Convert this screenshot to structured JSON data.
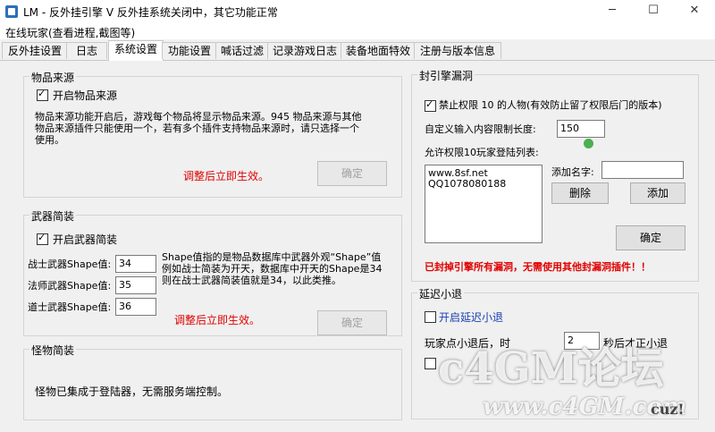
{
  "window": {
    "title": "LM - 反外挂引擎 V 反外挂系统关闭中，其它功能正常",
    "minimize": "─",
    "maximize": "☐",
    "close": "✕"
  },
  "menu": {
    "online_players": "在线玩家(查看进程,截图等)"
  },
  "tabs": [
    "反外挂设置",
    "日志",
    "系统设置",
    "功能设置",
    "喊话过滤",
    "记录游戏日志",
    "装备地面特效",
    "注册与版本信息"
  ],
  "item_source": {
    "group_title": "物品来源",
    "enable_label": "开启物品来源",
    "description": "物品来源功能开启后，游戏每个物品将显示物品来源。945 物品来源与其他物品来源插件只能使用一个，若有多个插件支持物品来源时，请只选择一个使用。",
    "note": "调整后立即生效。",
    "confirm": "确定"
  },
  "weapon_simple": {
    "group_title": "武器简装",
    "enable_label": "开启武器简装",
    "warrior_label": "战士武器Shape值:",
    "warrior_value": "34",
    "mage_label": "法师武器Shape值:",
    "mage_value": "35",
    "taoist_label": "道士武器Shape值:",
    "taoist_value": "36",
    "description": "Shape值指的是物品数据库中武器外观“Shape”值例如战士简装为开天，数据库中开天的Shape是34则在战士武器简装值就是34，以此类推。",
    "note": "调整后立即生效。",
    "confirm": "确定"
  },
  "monster_simple": {
    "group_title": "怪物简装",
    "description": "怪物已集成于登陆器，无需服务端控制。"
  },
  "engine_block": {
    "group_title": "封引擎漏洞",
    "ban_label": "禁止权限 10 的人物(有效防止留了权限后门的版本)",
    "custom_len_label": "自定义输入内容限制长度:",
    "custom_len_value": "150",
    "allow_list_label": "允许权限10玩家登陆列表:",
    "allow_list": [
      "www.8sf.net",
      "QQ1078080188"
    ],
    "add_name_label": "添加名字:",
    "add_name_value": "",
    "delete": "删除",
    "add": "添加",
    "confirm": "确定",
    "note": "已封掉引擎所有漏洞，无需使用其他封漏洞插件！！"
  },
  "delay_logout": {
    "group_title": "延迟小退",
    "enable_label": "开启延迟小退",
    "row_text": "玩家点小退后，时",
    "seconds_value": "2",
    "row_text_after": "秒后才正小退"
  },
  "watermark": {
    "brand": "c4GM论坛",
    "url": "www.c4GM.com",
    "suffix": "cuz!"
  },
  "colors": {
    "accent_red": "#e00000",
    "status_green": "#4caf50"
  }
}
